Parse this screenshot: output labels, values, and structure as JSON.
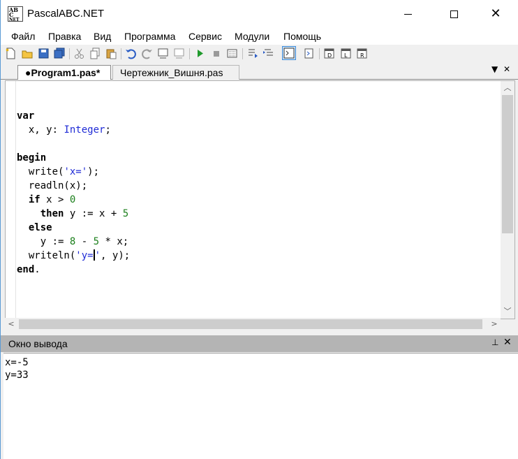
{
  "window": {
    "title": "PascalABC.NET",
    "icon_text_1": "AB",
    "icon_text_2": "C",
    "icon_text_3": "NET"
  },
  "menu": {
    "items": [
      "Файл",
      "Правка",
      "Вид",
      "Программа",
      "Сервис",
      "Модули",
      "Помощь"
    ]
  },
  "toolbar": {
    "icons": [
      "new-file-icon",
      "open-icon",
      "save-icon",
      "save-all-icon",
      "cut-icon",
      "copy-icon",
      "paste-icon",
      "undo-icon",
      "redo-icon",
      "format-icon",
      "format2-icon",
      "run-icon",
      "stop-icon",
      "debug-icon",
      "step-icon",
      "step-over-icon",
      "output-window-icon",
      "compile-icon",
      "form-icon",
      "windows-icon",
      "help-icon"
    ]
  },
  "tabs": [
    {
      "label": "●Program1.pas*",
      "active": true
    },
    {
      "label": "Чертежник_Вишня.pas",
      "active": false
    }
  ],
  "tab_controls": {
    "scroll_icon": "▼",
    "close_icon": "✕"
  },
  "editor": {
    "lines": [
      [
        {
          "t": "var",
          "c": "kw"
        }
      ],
      [
        {
          "t": "  x, y: ",
          "c": ""
        },
        {
          "t": "Integer",
          "c": "type"
        },
        {
          "t": ";",
          "c": ""
        }
      ],
      [
        {
          "t": "",
          "c": ""
        }
      ],
      [
        {
          "t": "begin",
          "c": "kw"
        }
      ],
      [
        {
          "t": "  write(",
          "c": ""
        },
        {
          "t": "'x='",
          "c": "str"
        },
        {
          "t": ");",
          "c": ""
        }
      ],
      [
        {
          "t": "  readln(x);",
          "c": ""
        }
      ],
      [
        {
          "t": "  ",
          "c": ""
        },
        {
          "t": "if",
          "c": "kw"
        },
        {
          "t": " x > ",
          "c": ""
        },
        {
          "t": "0",
          "c": "num"
        }
      ],
      [
        {
          "t": "    ",
          "c": ""
        },
        {
          "t": "then",
          "c": "kw"
        },
        {
          "t": " y := x + ",
          "c": ""
        },
        {
          "t": "5",
          "c": "num"
        }
      ],
      [
        {
          "t": "  ",
          "c": ""
        },
        {
          "t": "else",
          "c": "kw"
        }
      ],
      [
        {
          "t": "    y := ",
          "c": ""
        },
        {
          "t": "8",
          "c": "num"
        },
        {
          "t": " - ",
          "c": ""
        },
        {
          "t": "5",
          "c": "num"
        },
        {
          "t": " * x;",
          "c": ""
        }
      ],
      [
        {
          "t": "  writeln(",
          "c": ""
        },
        {
          "t": "'y=",
          "c": "str"
        },
        {
          "t": "|",
          "c": "caret"
        },
        {
          "t": "'",
          "c": "str"
        },
        {
          "t": ", y);",
          "c": ""
        }
      ],
      [
        {
          "t": "end",
          "c": "kw"
        },
        {
          "t": ".",
          "c": ""
        }
      ]
    ]
  },
  "output": {
    "title": "Окно вывода",
    "pin_icon": "📌",
    "close_icon": "✕",
    "text": "x=-5\ny=33"
  }
}
